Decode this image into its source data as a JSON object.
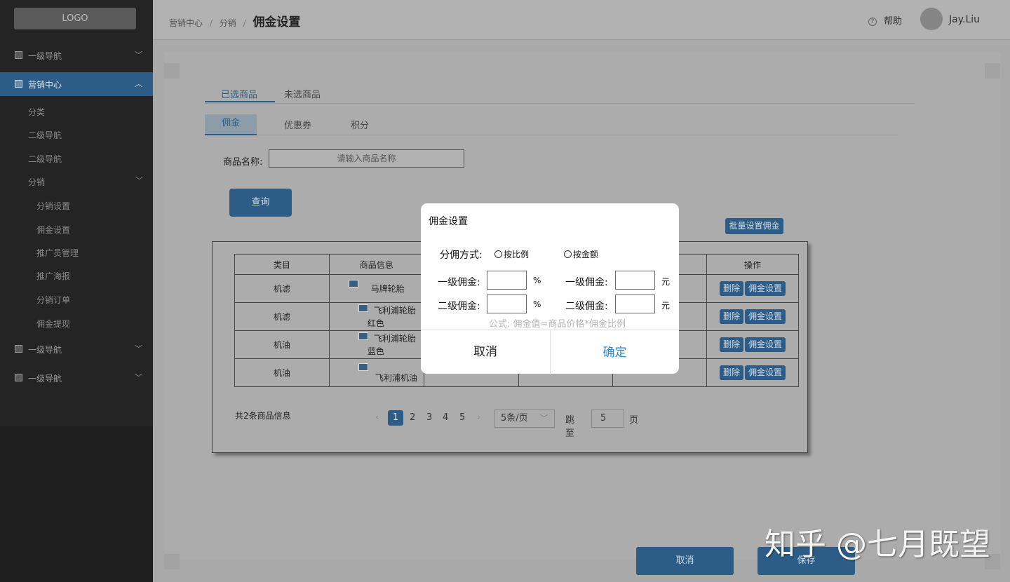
{
  "sidebar": {
    "logo": "LOGO",
    "nav1": "一级导航",
    "active": "营销中心",
    "sub_classify": "分类",
    "sub_nav2a": "二级导航",
    "sub_nav2b": "二级导航",
    "sub_fenxiao": "分销",
    "items": [
      "分销设置",
      "佣金设置",
      "推广员管理",
      "推广海报",
      "分销订单",
      "佣金提现"
    ],
    "nav2": "一级导航",
    "nav3": "一级导航"
  },
  "header": {
    "crumb1": "营销中心",
    "crumb2": "分销",
    "crumb_current": "佣金设置",
    "help": "帮助",
    "user": "Jay.Liu"
  },
  "main": {
    "tab_selected": "已选商品",
    "tab_unselected": "未选商品",
    "subtab_commission": "佣金",
    "subtab_coupon": "优惠券",
    "subtab_points": "积分",
    "name_label": "商品名称:",
    "name_placeholder": "请输入商品名称",
    "query": "查询",
    "batch": "批量设置佣金",
    "table": {
      "headers": [
        "类目",
        "商品信息",
        "",
        "",
        "",
        "操作"
      ],
      "rows": [
        {
          "category": "机滤",
          "name": "马牌轮胎",
          "sub": ""
        },
        {
          "category": "机滤",
          "name": "飞利浦轮胎",
          "sub": "红色"
        },
        {
          "category": "机油",
          "name": "飞利浦轮胎",
          "sub": "蓝色"
        },
        {
          "category": "机油",
          "name": "飞利浦机油",
          "sub": ""
        }
      ],
      "delete": "删除",
      "setting": "佣金设置"
    },
    "total": "共2条商品信息",
    "pager": {
      "prev": "‹",
      "pages": [
        "1",
        "2",
        "3",
        "4",
        "5"
      ],
      "next": "›",
      "size": "5条/页",
      "jump_label": "跳至",
      "jump_value": "5",
      "page_word": "页"
    },
    "cancel": "取消",
    "save": "保存"
  },
  "modal": {
    "title": "佣金设置",
    "mode_label": "分佣方式:",
    "mode_ratio": "按比例",
    "mode_amount": "按金额",
    "level1": "一级佣金:",
    "level2": "二级佣金:",
    "unit_percent": "%",
    "unit_yuan": "元",
    "formula": "公式: 佣金值=商品价格*佣金比例",
    "cancel": "取消",
    "confirm": "确定"
  },
  "watermark": "知乎 @七月既望"
}
